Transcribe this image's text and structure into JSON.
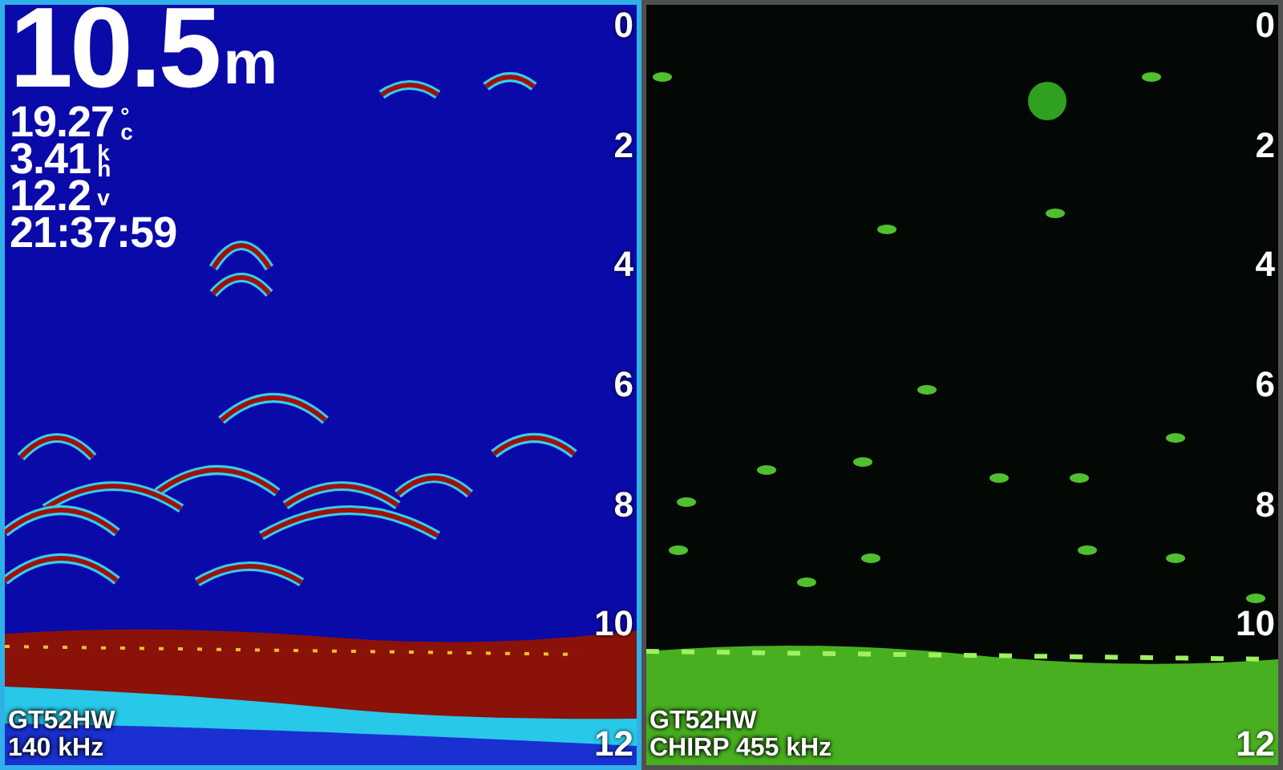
{
  "panels": [
    {
      "selected": true,
      "kind": "color",
      "readouts": [
        {
          "kind": "depth",
          "value": "10.5",
          "unit": [
            "m"
          ]
        },
        {
          "kind": "small",
          "value": "19.27",
          "unit": [
            "°",
            "c"
          ]
        },
        {
          "kind": "small",
          "value": "3.41",
          "unit": [
            "k",
            "h"
          ]
        },
        {
          "kind": "small",
          "value": "12.2",
          "unit": [
            "v"
          ]
        },
        {
          "kind": "small",
          "value": "21:37:59"
        }
      ],
      "scale": [
        "0",
        "2",
        "4",
        "6",
        "8",
        "10",
        "12"
      ],
      "source": [
        "GT52HW",
        "140 kHz"
      ]
    },
    {
      "selected": false,
      "kind": "green",
      "scale": [
        "0",
        "2",
        "4",
        "6",
        "8",
        "10",
        "12"
      ],
      "source": [
        "GT52HW",
        "CHIRP 455 kHz"
      ]
    }
  ]
}
